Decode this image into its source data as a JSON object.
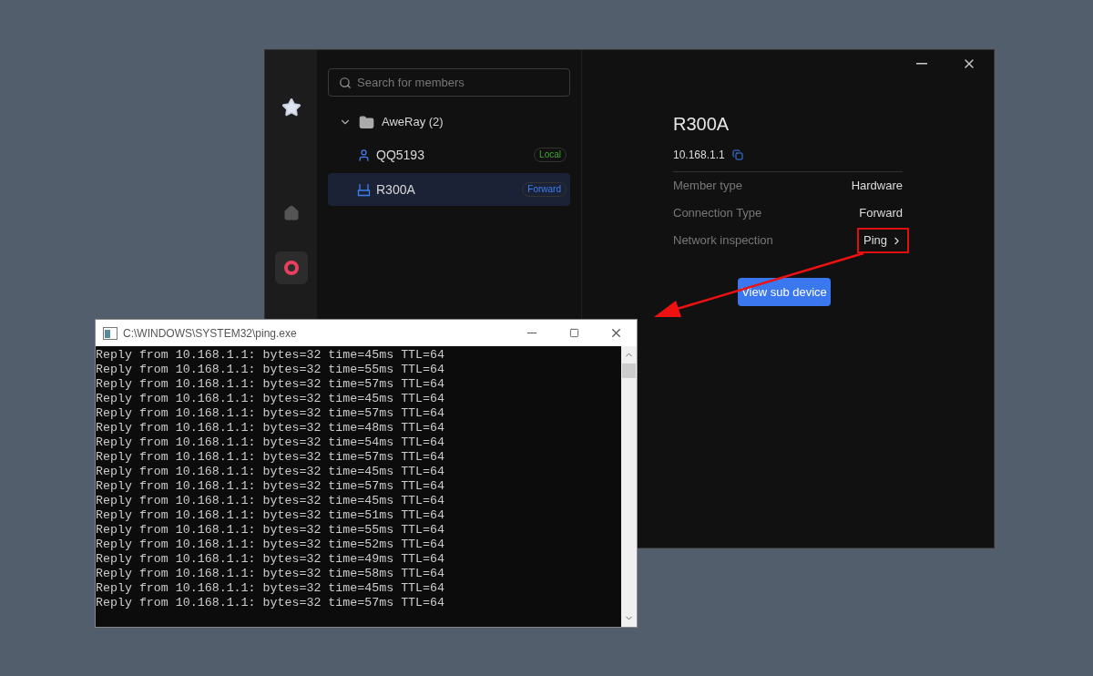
{
  "app": {
    "sidebar_icons": [
      {
        "kind": "star",
        "selected": false
      },
      {
        "kind": "home",
        "selected": false
      },
      {
        "kind": "chat",
        "selected": true
      }
    ],
    "search": {
      "placeholder": "Search for members"
    },
    "tree": [
      {
        "name": "AweRay (2)",
        "expanded": true,
        "children": [
          {
            "name": "QQ5193",
            "kind": "user",
            "badge": "Local",
            "color": "#3fa52c",
            "selected": false
          },
          {
            "name": "R300A",
            "kind": "router",
            "badge": "Forward",
            "color": "#3d7ef0",
            "selected": true
          }
        ]
      }
    ],
    "detail": {
      "title": "R300A",
      "address": "10.168.1.1",
      "fields": [
        {
          "label": "Member type",
          "value": "Hardware"
        },
        {
          "label": "Connection Type",
          "value": "Forward"
        }
      ],
      "inspection": {
        "label": "Network inspection",
        "link": "Ping"
      },
      "button": "View sub device"
    }
  },
  "console": {
    "title": "C:\\WINDOWS\\SYSTEM32\\ping.exe",
    "lines": [
      "Reply from 10.168.1.1: bytes=32 time=45ms TTL=64",
      "Reply from 10.168.1.1: bytes=32 time=55ms TTL=64",
      "Reply from 10.168.1.1: bytes=32 time=57ms TTL=64",
      "Reply from 10.168.1.1: bytes=32 time=45ms TTL=64",
      "Reply from 10.168.1.1: bytes=32 time=57ms TTL=64",
      "Reply from 10.168.1.1: bytes=32 time=48ms TTL=64",
      "Reply from 10.168.1.1: bytes=32 time=54ms TTL=64",
      "Reply from 10.168.1.1: bytes=32 time=57ms TTL=64",
      "Reply from 10.168.1.1: bytes=32 time=45ms TTL=64",
      "Reply from 10.168.1.1: bytes=32 time=57ms TTL=64",
      "Reply from 10.168.1.1: bytes=32 time=45ms TTL=64",
      "Reply from 10.168.1.1: bytes=32 time=51ms TTL=64",
      "Reply from 10.168.1.1: bytes=32 time=55ms TTL=64",
      "Reply from 10.168.1.1: bytes=32 time=52ms TTL=64",
      "Reply from 10.168.1.1: bytes=32 time=49ms TTL=64",
      "Reply from 10.168.1.1: bytes=32 time=58ms TTL=64",
      "Reply from 10.168.1.1: bytes=32 time=45ms TTL=64",
      "Reply from 10.168.1.1: bytes=32 time=57ms TTL=64"
    ]
  }
}
